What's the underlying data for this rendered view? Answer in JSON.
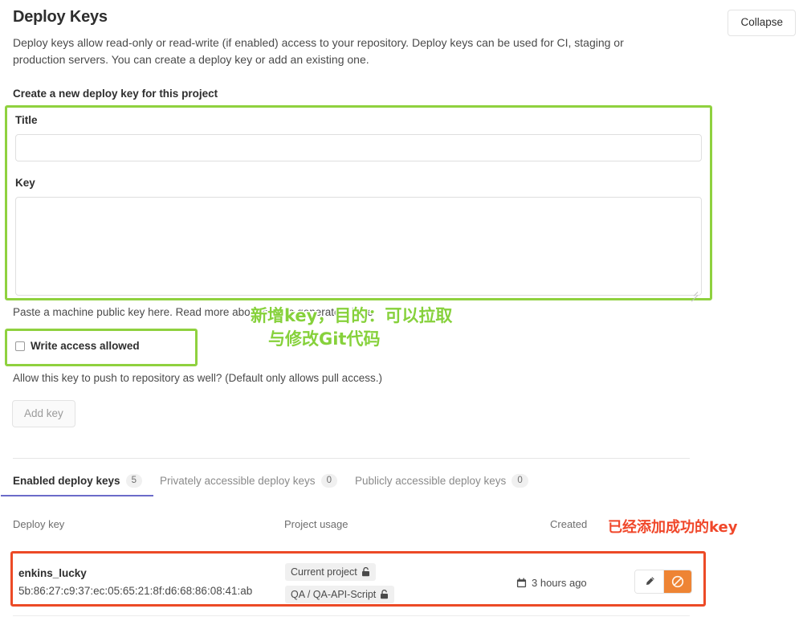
{
  "header": {
    "title": "Deploy Keys",
    "description": "Deploy keys allow read-only or read-write (if enabled) access to your repository. Deploy keys can be used for CI, staging or production servers. You can create a deploy key or add an existing one.",
    "collapse_label": "Collapse"
  },
  "form": {
    "section_label": "Create a new deploy key for this project",
    "title_label": "Title",
    "title_value": "",
    "title_placeholder": "",
    "key_label": "Key",
    "key_value": "",
    "key_placeholder": "",
    "paste_hint": "Paste a machine public key here. Read more about how to generate it here",
    "write_access_label": "Write access allowed",
    "write_access_checked": false,
    "write_access_hint": "Allow this key to push to repository as well? (Default only allows pull access.)",
    "add_key_label": "Add key"
  },
  "annotations": {
    "green_line1": "新增key，目的：可以拉取",
    "green_line2": "与修改Git代码",
    "green_color": "#86d13b",
    "red_text": "已经添加成功的key",
    "red_color": "#f0472a"
  },
  "tabs": [
    {
      "label": "Enabled deploy keys",
      "count": "5",
      "active": true
    },
    {
      "label": "Privately accessible deploy keys",
      "count": "0",
      "active": false
    },
    {
      "label": "Publicly accessible deploy keys",
      "count": "0",
      "active": false
    }
  ],
  "table": {
    "columns": {
      "key": "Deploy key",
      "usage": "Project usage",
      "created": "Created"
    },
    "rows": [
      {
        "name": "enkins_lucky",
        "fingerprint": "5b:86:27:c9:37:ec:05:65:21:8f:d6:68:86:08:41:ab",
        "badges": [
          "Current project",
          "QA / QA-API-Script"
        ],
        "created": "3 hours ago",
        "calendar_icon": "calendar-icon",
        "edit_icon": "pencil-icon",
        "disable_icon": "ban-icon",
        "disable_color": "#ee8434"
      }
    ]
  }
}
